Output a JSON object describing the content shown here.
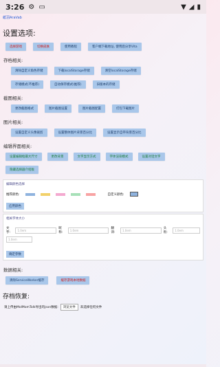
{
  "status": {
    "time": "3:26"
  },
  "app": {
    "title": "紙羽AraVab"
  },
  "settings_title": "设置选项:",
  "top_buttons": [
    {
      "label": "选择游戏",
      "color": "red"
    },
    {
      "label": "切换皮肤",
      "color": "red"
    },
    {
      "label": "使用教程",
      "color": "normal"
    },
    {
      "label": "客户端下载地址, 使用后分享Vita",
      "color": "normal"
    }
  ],
  "storage": {
    "title": "存档相关:",
    "row1": [
      "清除自定义角色存储",
      "下载localStorage存储",
      "清空localStorage存储"
    ],
    "row2": [
      "存储模式(不推荐)",
      "自动保存模式(推荐)",
      "旧版本的存储"
    ]
  },
  "screenshot": {
    "title": "截图相关:",
    "buttons": [
      "更改截图格式",
      "图片截图设置",
      "图片截图配置",
      "打包下载图片"
    ]
  },
  "image": {
    "title": "图片相关:",
    "buttons": [
      "设置自定义头像裁剪",
      "设置整体图片背景百分比",
      "设置显示自带背景百分比"
    ]
  },
  "editor": {
    "title": "编辑界面相关:",
    "buttons": [
      {
        "label": "设置编辑框最大尺寸",
        "color": "green"
      },
      {
        "label": "更改背景",
        "color": "green"
      },
      {
        "label": "文字显示方式",
        "color": "green"
      },
      {
        "label": "字体渲染模式",
        "color": "green"
      },
      {
        "label": "设置对话文字",
        "color": "green"
      },
      {
        "label": "隐藏选择器介绍板",
        "color": "green"
      }
    ]
  },
  "color_panel": {
    "title": "编辑颜色选择",
    "label_left": "推荐颜色:",
    "label_right": "自定义颜色:",
    "swatches": [
      "#8fb3de",
      "#f2d16a",
      "#f4a9d0",
      "#a7e0b8",
      "#f8a3a3"
    ],
    "custom_color": "#8fb3de",
    "apply": "应用颜色"
  },
  "font_panel": {
    "title": "相关字体大小",
    "fields": [
      {
        "label": "文字:",
        "placeholder": "1.0em"
      },
      {
        "label": "昵称:",
        "placeholder": "1.0em"
      },
      {
        "label": "翻译:",
        "placeholder": "1.0em"
      },
      {
        "label": "头衔:",
        "placeholder": "1.0em"
      }
    ],
    "extra_placeholder": "1.0em",
    "apply": "确定参数"
  },
  "data": {
    "title": "数据相关:",
    "buttons": [
      {
        "label": "清除ServiceWorker缓存",
        "color": "normal"
      },
      {
        "label": "缓存游戏本地数据",
        "color": "red"
      }
    ]
  },
  "restore": {
    "title": "存档恢复:",
    "label": "请上传由MolMomTalk导出的json数据:",
    "file_button": "浏览文件",
    "file_status": "未选择任何文件"
  }
}
